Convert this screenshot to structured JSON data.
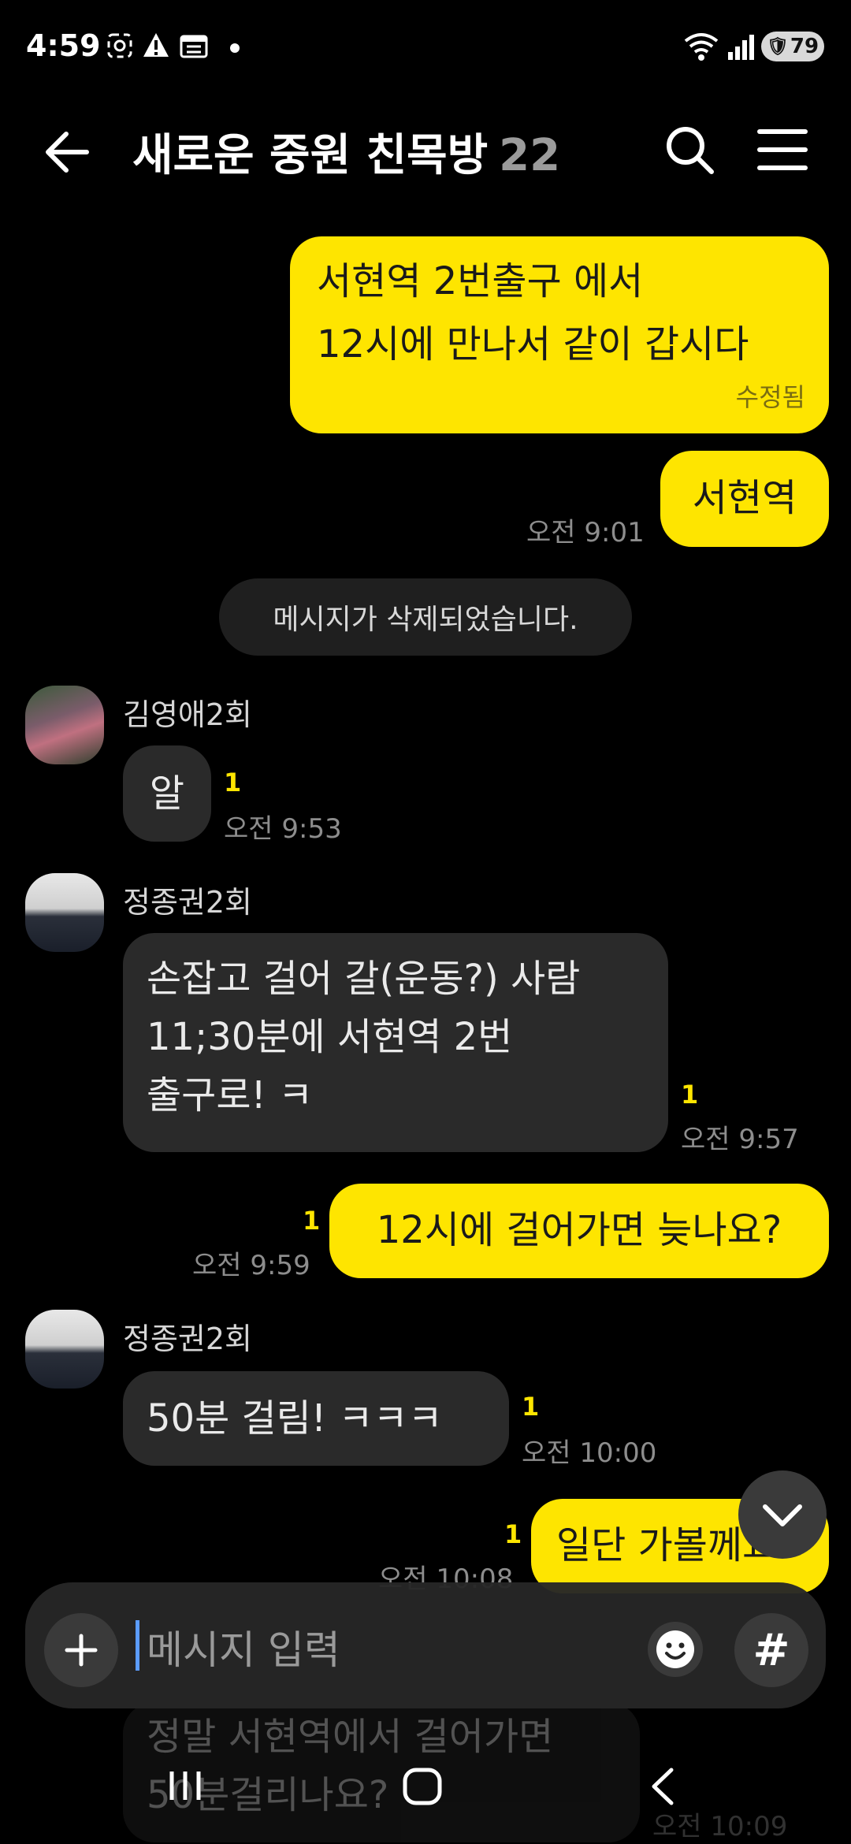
{
  "status": {
    "time": "4:59",
    "battery": "79"
  },
  "header": {
    "title": "새로운 중원 친목방",
    "member_count": "22"
  },
  "messages": [
    {
      "lines": [
        "서현역  2번출구 에서",
        "12시에 만나서  같이 갑시다"
      ],
      "edited": "수정됨"
    },
    {
      "text": "서현역",
      "time": "오전 9:01"
    },
    {
      "system": "메시지가 삭제되었습니다."
    },
    {
      "sender": "김영애2회",
      "text": "알",
      "unread": "1",
      "time": "오전 9:53"
    },
    {
      "sender": "정종권2회",
      "lines": [
        "손잡고 걸어 갈(운동?) 사람",
        "11;30분에 서현역 2번",
        "출구로! ㅋ"
      ],
      "unread": "1",
      "time": "오전 9:57"
    },
    {
      "text": "12시에 걸어가면 늦나요?",
      "unread": "1",
      "time": "오전 9:59"
    },
    {
      "sender": "정종권2회",
      "text": "50분 걸림! ㅋㅋㅋ",
      "unread": "1",
      "time": "오전 10:00"
    },
    {
      "text": "일단 가볼께요",
      "unread": "1",
      "time": "오전 10:08"
    },
    {
      "lines": [
        "정말 서현역에서 걸어가면",
        "50분걸리나요?"
      ],
      "time": "오전 10:09"
    }
  ],
  "input": {
    "placeholder": "메시지 입력",
    "hash": "#"
  },
  "colors": {
    "my_bubble": "#fee500",
    "other_bubble": "#2a2a2a",
    "background": "#000000"
  }
}
